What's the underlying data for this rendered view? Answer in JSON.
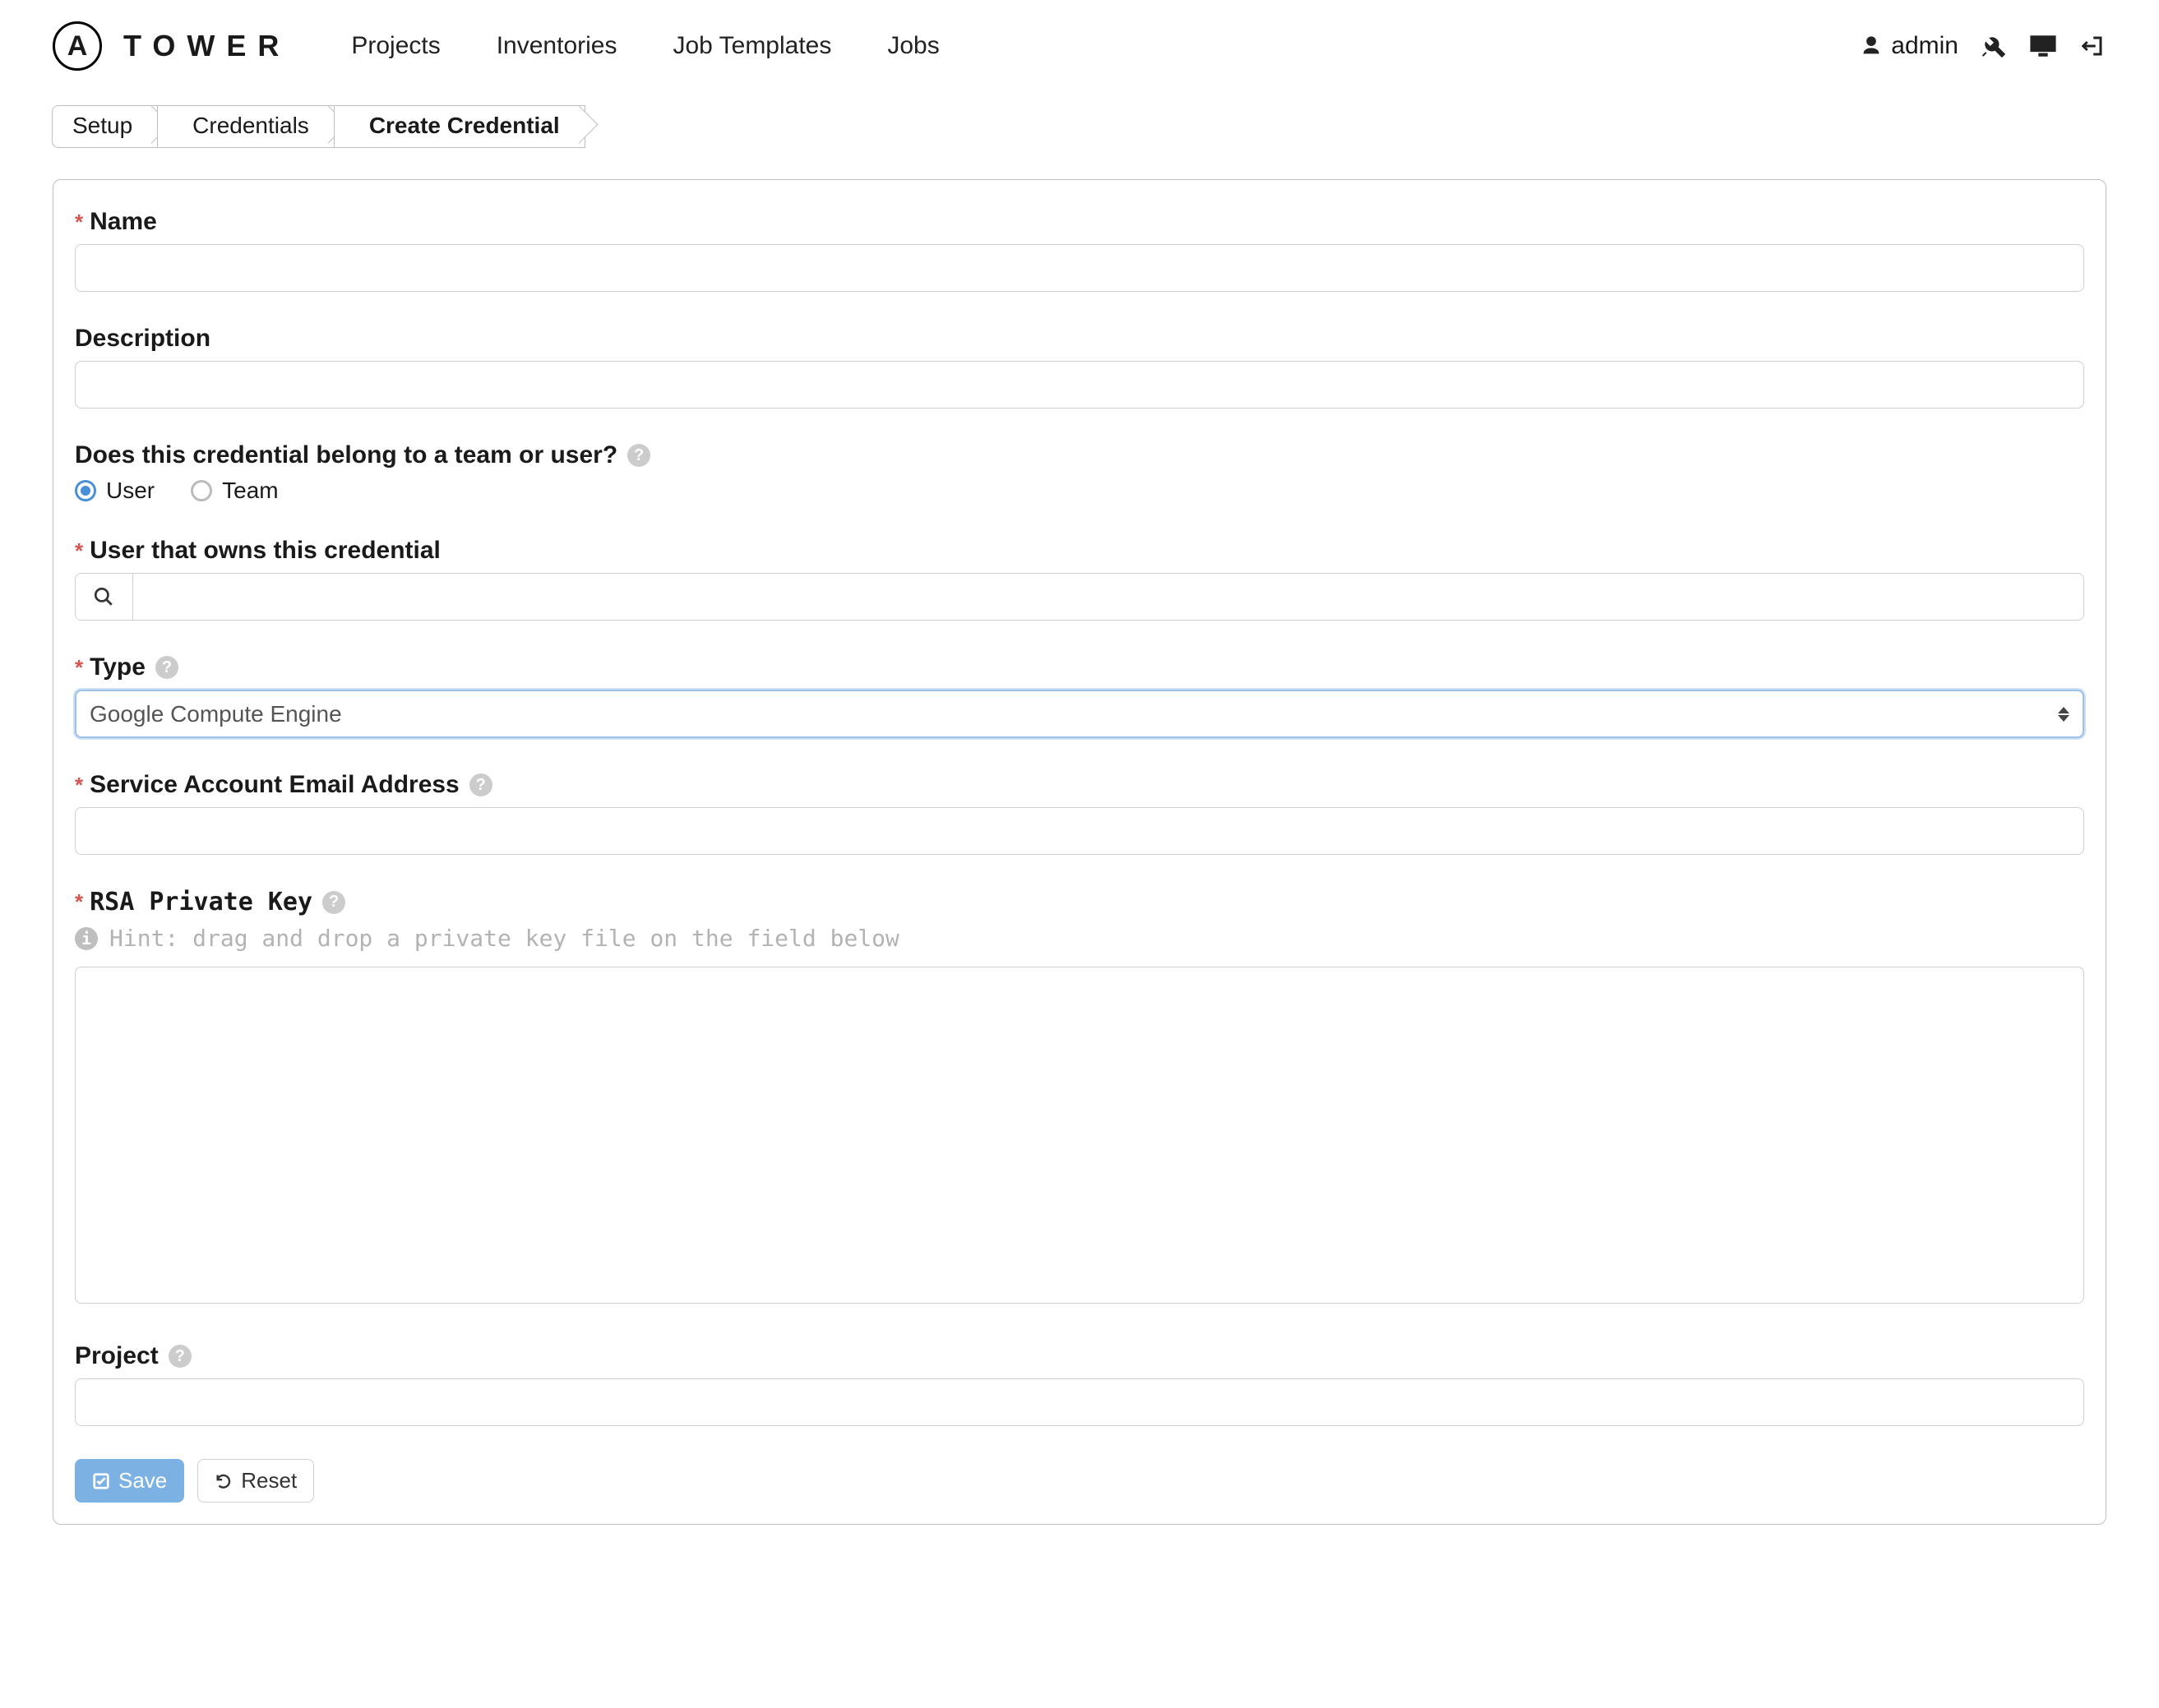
{
  "brand": "TOWER",
  "nav": {
    "projects": "Projects",
    "inventories": "Inventories",
    "job_templates": "Job Templates",
    "jobs": "Jobs"
  },
  "user": {
    "name": "admin"
  },
  "breadcrumbs": {
    "setup": "Setup",
    "credentials": "Credentials",
    "create": "Create Credential"
  },
  "form": {
    "name_label": "Name",
    "description_label": "Description",
    "owner_question": "Does this credential belong to a team or user?",
    "owner_user": "User",
    "owner_team": "Team",
    "user_owner_label": "User that owns this credential",
    "type_label": "Type",
    "type_value": "Google Compute Engine",
    "email_label": "Service Account Email Address",
    "rsa_label": "RSA Private Key",
    "rsa_hint": "Hint: drag and drop a private key file on the field below",
    "project_label": "Project",
    "save": "Save",
    "reset": "Reset"
  }
}
